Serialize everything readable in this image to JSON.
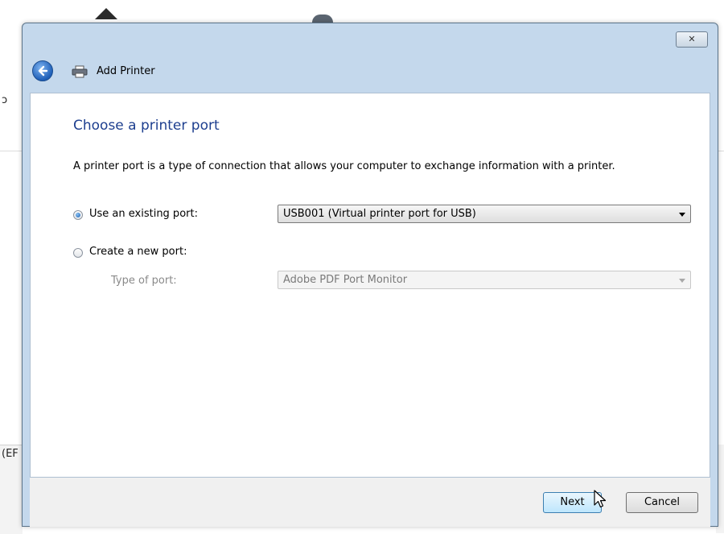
{
  "window": {
    "title": "Add Printer",
    "close_label": "✕"
  },
  "page": {
    "heading": "Choose a printer port",
    "description": "A printer port is a type of connection that allows your computer to exchange information with a printer."
  },
  "options": {
    "existing_port": {
      "label": "Use an existing port:",
      "selected": true,
      "value": "USB001 (Virtual printer port for USB)"
    },
    "new_port": {
      "label": "Create a new port:",
      "selected": false,
      "type_label": "Type of port:",
      "type_value": "Adobe PDF Port Monitor"
    }
  },
  "buttons": {
    "next_label": "Next",
    "cancel_label": "Cancel"
  },
  "background": {
    "left_text_top": "ↄ",
    "left_text_bottom": "(EF"
  },
  "icons": {
    "back": "back-arrow-icon",
    "printer": "printer-icon",
    "close": "close-icon",
    "dropdown": "chevron-down-icon",
    "cursor": "mouse-cursor-icon"
  }
}
